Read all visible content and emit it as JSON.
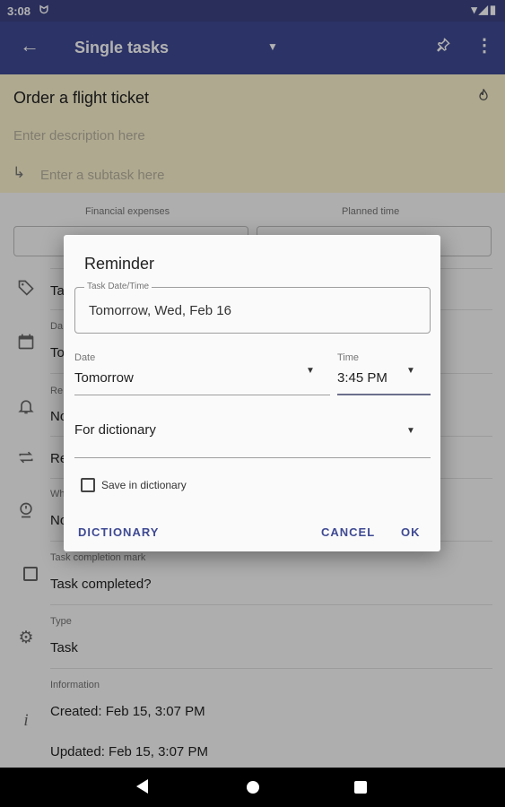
{
  "status_bar": {
    "time": "3:08",
    "notif_icon": "cat-notification-icon",
    "right_icons": "▾◢▮"
  },
  "app_bar": {
    "title": "Single tasks",
    "back_icon": "←",
    "dropdown_icon": "▼",
    "pin_icon": "📌",
    "more_icon": "⋮"
  },
  "task": {
    "title": "Order a flight ticket",
    "description_placeholder": "Enter description here",
    "subtask_placeholder": "Enter a subtask here",
    "flame_icon": "🔥",
    "subtask_icon": "↳"
  },
  "details": {
    "financial_label": "Financial expenses",
    "planned_label": "Planned time",
    "tags_text": "Ta",
    "date_caption": "Da",
    "date_text": "To",
    "reminder_caption": "Re",
    "reminder_text": "No",
    "repeat_text": "Re",
    "who_caption": "Wh",
    "who_text": "No",
    "completion_caption": "Task completion mark",
    "completion_text": "Task completed?",
    "type_caption": "Type",
    "type_text": "Task",
    "info_caption": "Information",
    "created_text": "Created: Feb 15, 3:07 PM",
    "updated_text": "Updated: Feb 15, 3:07 PM"
  },
  "dialog": {
    "title": "Reminder",
    "datetime_label": "Task Date/Time",
    "datetime_value": "Tomorrow, Wed, Feb 16",
    "date_label": "Date",
    "date_value": "Tomorrow",
    "time_label": "Time",
    "time_value": "3:45 PM",
    "dictionary_value": "For dictionary",
    "save_label": "Save in dictionary",
    "dictionary_button": "DICTIONARY",
    "cancel_button": "CANCEL",
    "ok_button": "OK"
  },
  "colors": {
    "primary": "#3f4a93",
    "status_bar": "#3b4283",
    "task_header": "#fbf3cf"
  }
}
